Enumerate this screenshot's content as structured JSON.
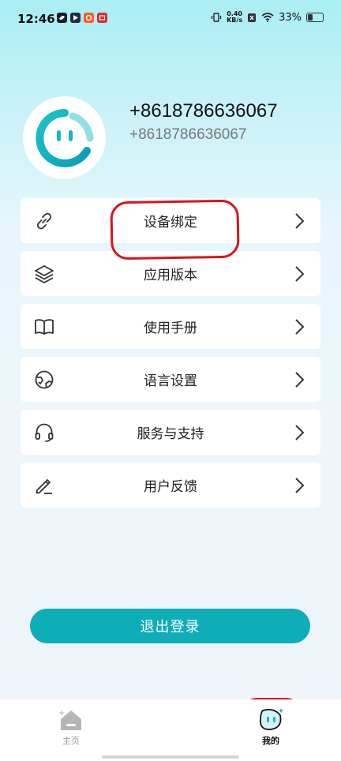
{
  "status_bar": {
    "time": "12:46",
    "net_speed_value": "0.40",
    "net_speed_unit": "KB/s",
    "battery": "33%"
  },
  "profile": {
    "phone": "+8618786636067",
    "subtitle": "+8618786636067"
  },
  "menu": [
    {
      "label": "设备绑定",
      "icon": "link-icon"
    },
    {
      "label": "应用版本",
      "icon": "layers-icon"
    },
    {
      "label": "使用手册",
      "icon": "book-icon"
    },
    {
      "label": "语言设置",
      "icon": "globe-icon"
    },
    {
      "label": "服务与支持",
      "icon": "headset-icon"
    },
    {
      "label": "用户反馈",
      "icon": "edit-icon"
    }
  ],
  "logout_label": "退出登录",
  "tabs": [
    {
      "label": "主页",
      "icon": "home-icon",
      "active": false
    },
    {
      "label": "我的",
      "icon": "robot-face-icon",
      "active": true
    }
  ],
  "colors": {
    "accent": "#0fadb8",
    "annotation": "#d8141c"
  }
}
